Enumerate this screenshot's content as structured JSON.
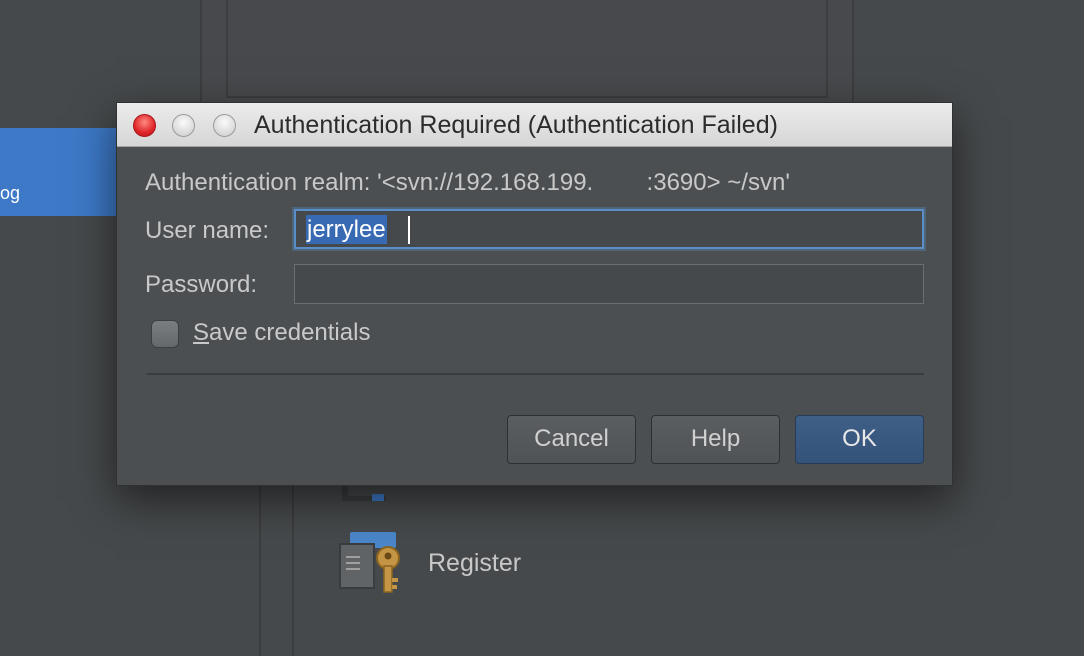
{
  "background": {
    "sidebar_selected_label": "og",
    "register_label": "Register"
  },
  "dialog": {
    "title": "Authentication Required (Authentication Failed)",
    "realm_text": "Authentication realm: '<svn://192.168.199.        :3690> ~/svn'",
    "username_label": "User name:",
    "username_value": "jerrylee",
    "password_label": "Password:",
    "password_value": "",
    "save_credentials_first": "S",
    "save_credentials_rest": "ave credentials",
    "save_credentials_checked": false,
    "buttons": {
      "cancel": "Cancel",
      "help": "Help",
      "ok": "OK"
    }
  },
  "colors": {
    "accent": "#3d79c7",
    "default_button": "#3f5f86",
    "selection": "#3869b3",
    "close_button": "#e0262a"
  },
  "icons": [
    "close-window-icon",
    "minimize-window-icon",
    "maximize-window-icon",
    "register-key-icon"
  ]
}
